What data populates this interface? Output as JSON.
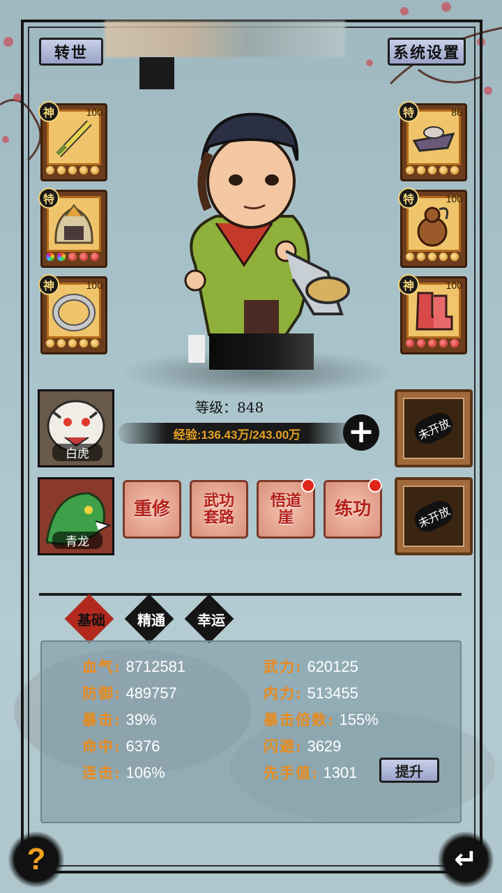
{
  "header": {
    "rebirth_label": "转世",
    "settings_label": "系统设置"
  },
  "equipment": {
    "left": [
      {
        "rank": "神",
        "level": "100",
        "icon": "sword-icon",
        "stars": [
          "gold",
          "gold",
          "gold",
          "gold",
          "gold"
        ]
      },
      {
        "rank": "特",
        "level": "",
        "icon": "helmet-icon",
        "stars": [
          "rainbow",
          "rainbow",
          "red",
          "red",
          "red"
        ]
      },
      {
        "rank": "神",
        "level": "100",
        "icon": "ring-icon",
        "stars": [
          "gold",
          "gold",
          "gold",
          "gold",
          "gold"
        ]
      }
    ],
    "right": [
      {
        "rank": "特",
        "level": "86",
        "icon": "hat-icon",
        "stars": [
          "gold",
          "gold",
          "gold",
          "gold",
          "gold"
        ]
      },
      {
        "rank": "特",
        "level": "100",
        "icon": "gourd-icon",
        "stars": [
          "gold",
          "gold",
          "gold",
          "gold",
          "gold"
        ]
      },
      {
        "rank": "神",
        "level": "100",
        "icon": "boots-icon",
        "stars": [
          "red",
          "red",
          "red",
          "red",
          "red"
        ]
      }
    ]
  },
  "hero": {
    "level_label": "等级：848",
    "exp_label": "经验:136.43万/243.00万"
  },
  "pets": [
    {
      "name": "白虎",
      "icon": "white-tiger-icon"
    },
    {
      "name": "青龙",
      "icon": "green-dragon-icon"
    }
  ],
  "locked_slots": [
    {
      "label": "未开放"
    },
    {
      "label": "未开放"
    }
  ],
  "actions": [
    {
      "label": "重修",
      "badge": false
    },
    {
      "label": "武功套路",
      "badge": false
    },
    {
      "label": "悟道崖",
      "badge": true
    },
    {
      "label": "练功",
      "badge": true
    }
  ],
  "tabs": [
    {
      "label": "基础",
      "active": true
    },
    {
      "label": "精通",
      "active": false
    },
    {
      "label": "幸运",
      "active": false
    }
  ],
  "stats": {
    "left": [
      {
        "key": "血气:",
        "value": "8712581"
      },
      {
        "key": "防御:",
        "value": "489757"
      },
      {
        "key": "暴击:",
        "value": "39%"
      },
      {
        "key": "命中:",
        "value": "6376"
      },
      {
        "key": "连击:",
        "value": "106%"
      }
    ],
    "right": [
      {
        "key": "武力:",
        "value": "620125"
      },
      {
        "key": "内力:",
        "value": "513455"
      },
      {
        "key": "暴击倍数:",
        "value": "155%"
      },
      {
        "key": "闪避:",
        "value": "3629"
      },
      {
        "key": "先手值:",
        "value": "1301"
      }
    ],
    "upgrade_label": "提升"
  },
  "footer": {
    "help_glyph": "?",
    "back_glyph": "↵"
  },
  "colors": {
    "stat_key": "#e88a1d",
    "accent_red": "#b3201a",
    "frame": "#161616"
  }
}
